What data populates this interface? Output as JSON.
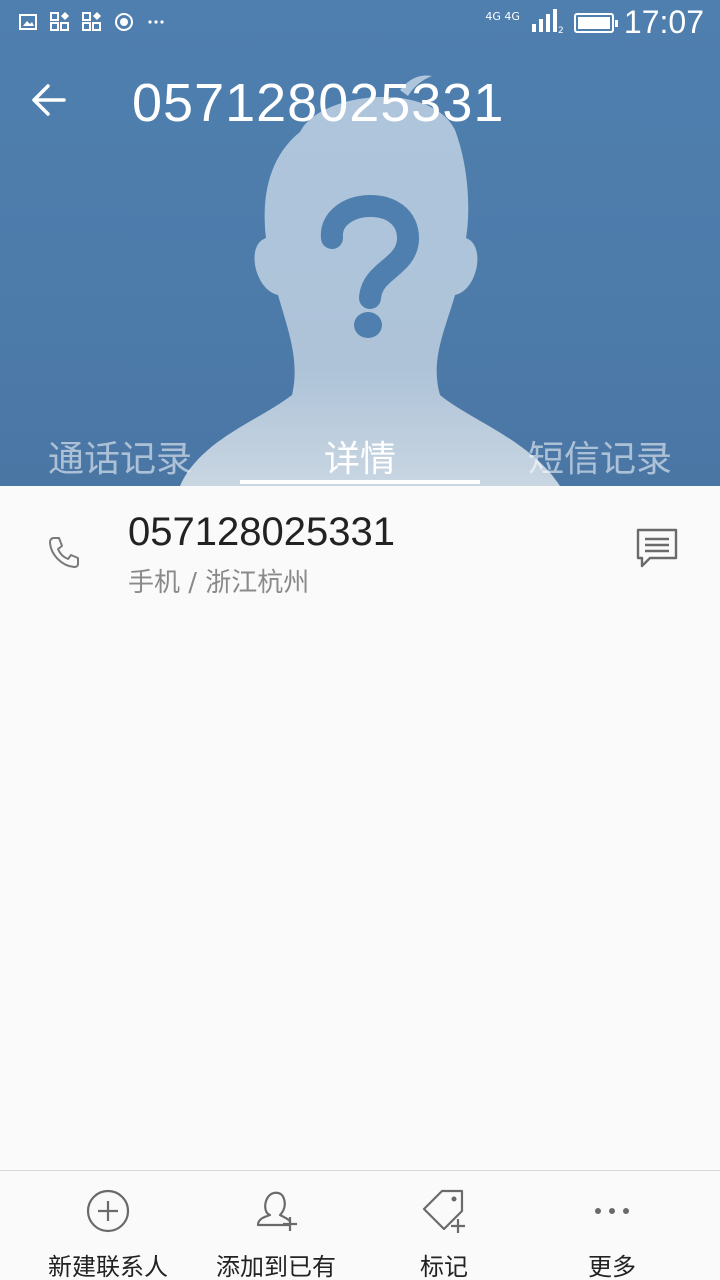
{
  "status_bar": {
    "network": "4G 4G",
    "sim_index": "2",
    "time": "17:07"
  },
  "header": {
    "title": "057128025331",
    "back_icon": "arrow-left-icon",
    "avatar": "unknown-contact-silhouette",
    "background_color": "#4f7fae"
  },
  "tabs": [
    {
      "label": "通话记录",
      "active": false
    },
    {
      "label": "详情",
      "active": true
    },
    {
      "label": "短信记录",
      "active": false
    }
  ],
  "detail": {
    "number": "057128025331",
    "location": "手机 / 浙江杭州",
    "left_icon": "phone-icon",
    "right_icon": "message-icon"
  },
  "bottom_bar": [
    {
      "label": "新建联系人",
      "icon": "add-circle-icon"
    },
    {
      "label": "添加到已有",
      "icon": "add-person-icon"
    },
    {
      "label": "标记",
      "icon": "tag-icon"
    },
    {
      "label": "更多",
      "icon": "more-icon"
    }
  ]
}
